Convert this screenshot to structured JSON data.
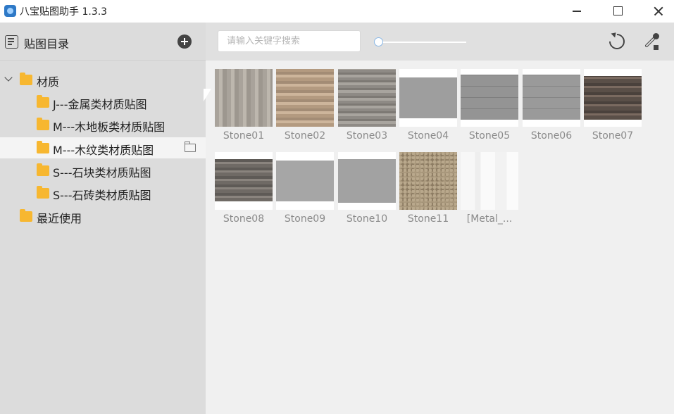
{
  "window": {
    "title": "八宝贴图助手 1.3.3"
  },
  "sidebar": {
    "title": "贴图目录",
    "tree": [
      {
        "label": "材质",
        "level": 0,
        "expanded": true
      },
      {
        "label": "J---金属类材质贴图",
        "level": 1
      },
      {
        "label": "M---木地板类材质贴图",
        "level": 1
      },
      {
        "label": "M---木纹类材质贴图",
        "level": 1,
        "selected": true
      },
      {
        "label": "S---石块类材质贴图",
        "level": 1
      },
      {
        "label": "S---石砖类材质贴图",
        "level": 1
      },
      {
        "label": "最近使用",
        "level": 0
      }
    ]
  },
  "toolbar": {
    "search_placeholder": "请输入关键字搜索",
    "slider_value": 0.0
  },
  "tiles": [
    {
      "label": "Stone01"
    },
    {
      "label": "Stone02"
    },
    {
      "label": "Stone03"
    },
    {
      "label": "Stone04"
    },
    {
      "label": "Stone05"
    },
    {
      "label": "Stone06"
    },
    {
      "label": "Stone07"
    },
    {
      "label": "Stone08"
    },
    {
      "label": "Stone09"
    },
    {
      "label": "Stone10"
    },
    {
      "label": "Stone11"
    },
    {
      "label": "[Metal_..."
    }
  ],
  "colors": {
    "folder": "#f7b730",
    "selected_row": "#f4f4f4",
    "label_gray": "#8a8a8a"
  }
}
